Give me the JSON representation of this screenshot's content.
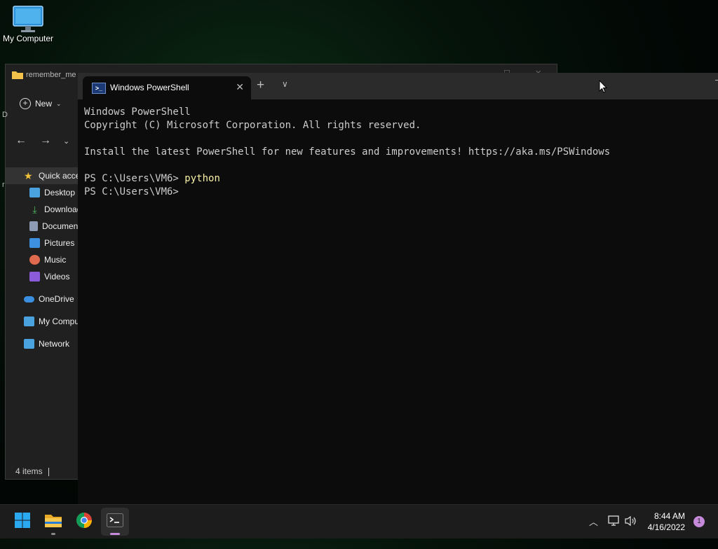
{
  "desktop": {
    "icons": [
      {
        "label": "My Computer",
        "icon": "computer-monitor-icon"
      }
    ]
  },
  "explorer": {
    "title": "remember_me",
    "new_label": "New",
    "left_fragments": [
      "D",
      "r"
    ],
    "sidebar": [
      {
        "label": "Quick access",
        "icon": "star-icon",
        "color": "#f2c33b"
      },
      {
        "label": "Desktop",
        "icon": "desktop-folder-icon",
        "color": "#4aa3df"
      },
      {
        "label": "Downloads",
        "icon": "download-icon",
        "color": "#4fb45b"
      },
      {
        "label": "Documents",
        "icon": "document-icon",
        "color": "#8d9bb4"
      },
      {
        "label": "Pictures",
        "icon": "pictures-icon",
        "color": "#3d8fe0"
      },
      {
        "label": "Music",
        "icon": "music-icon",
        "color": "#e06a4e"
      },
      {
        "label": "Videos",
        "icon": "videos-icon",
        "color": "#8c5bd9"
      },
      {
        "label": "OneDrive",
        "icon": "cloud-icon",
        "color": "#3a8fe0"
      },
      {
        "label": "My Computer",
        "icon": "computer-icon",
        "color": "#4aa3df"
      },
      {
        "label": "Network",
        "icon": "network-icon",
        "color": "#4aa3df"
      }
    ],
    "status": "4 items"
  },
  "terminal": {
    "tab_title": "Windows PowerShell",
    "lines": [
      {
        "text": "Windows PowerShell"
      },
      {
        "text": "Copyright (C) Microsoft Corporation. All rights reserved."
      },
      {
        "text": ""
      },
      {
        "text": "Install the latest PowerShell for new features and improvements! https://aka.ms/PSWindows"
      },
      {
        "text": ""
      },
      {
        "prompt": "PS C:\\Users\\VM6> ",
        "command": "python"
      },
      {
        "prompt": "PS C:\\Users\\VM6> ",
        "command": ""
      }
    ]
  },
  "taskbar": {
    "apps": [
      "start-icon",
      "file-explorer-icon",
      "chrome-icon",
      "terminal-icon"
    ],
    "time": "8:44 AM",
    "date": "4/16/2022",
    "notification_count": "1"
  }
}
